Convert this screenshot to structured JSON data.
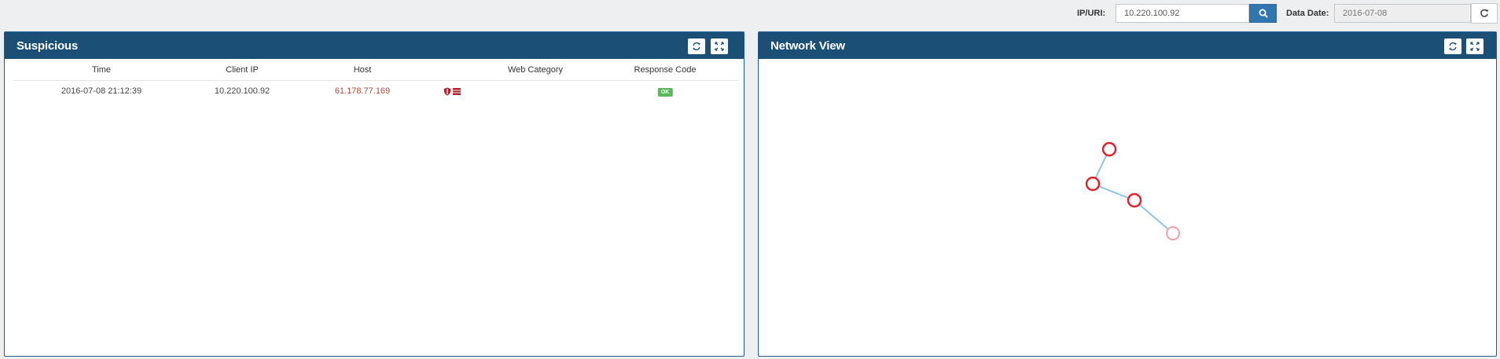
{
  "toolbar": {
    "ip_label": "IP/URI:",
    "ip_value": "10.220.100.92",
    "date_label": "Data Date:",
    "date_value": "2016-07-08"
  },
  "suspicious": {
    "title": "Suspicious",
    "columns": [
      "Time",
      "Client IP",
      "Host",
      "Web Category",
      "Response Code"
    ],
    "rows": [
      {
        "time": "2016-07-08 21:12:39",
        "client_ip": "10.220.100.92",
        "host": "61.178.77.169",
        "web_category": "",
        "response_code": "OK"
      }
    ]
  },
  "network_view": {
    "title": "Network View",
    "nodes": 4,
    "edges": 3
  },
  "colors": {
    "panel_header": "#1b4f76",
    "primary_button": "#3276b1",
    "host_text": "#b04a3c",
    "ok_badge": "#5cb85c",
    "node_stroke": "#e0232e",
    "edge": "#8ec3e6"
  }
}
